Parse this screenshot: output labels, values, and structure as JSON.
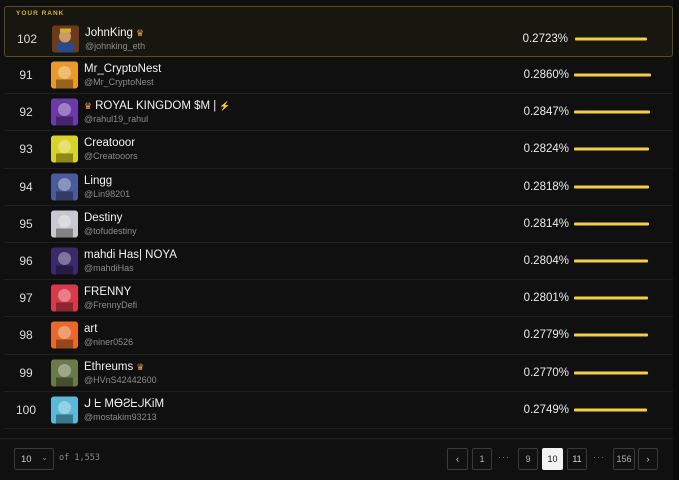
{
  "your_rank_label": "YOUR RANK",
  "my_entry": {
    "rank": "102",
    "name": "JohnKing",
    "handle": "@johnking_eth",
    "pct": "0.2723%",
    "share": 0.9,
    "crown": true
  },
  "entries": [
    {
      "rank": "91",
      "name": "Mr_CryptoNest",
      "handle": "@Mr_CryptoNest",
      "pct": "0.2860%",
      "share": 0.96,
      "crown": false,
      "prefix_crown": false,
      "bolt": false
    },
    {
      "rank": "92",
      "name": "ROYAL KINGDOM $M |",
      "handle": "@rahul19_rahul",
      "pct": "0.2847%",
      "share": 0.95,
      "crown": false,
      "prefix_crown": true,
      "bolt": true
    },
    {
      "rank": "93",
      "name": "Creatooor",
      "handle": "@Creatooors",
      "pct": "0.2824%",
      "share": 0.94,
      "crown": false,
      "prefix_crown": false,
      "bolt": false
    },
    {
      "rank": "94",
      "name": "Lingg",
      "handle": "@Lin98201",
      "pct": "0.2818%",
      "share": 0.94,
      "crown": false,
      "prefix_crown": false,
      "bolt": false
    },
    {
      "rank": "95",
      "name": "Destiny",
      "handle": "@tofudestiny",
      "pct": "0.2814%",
      "share": 0.94,
      "crown": false,
      "prefix_crown": false,
      "bolt": false
    },
    {
      "rank": "96",
      "name": "mahdi Has| NOYA",
      "handle": "@mahdiHas",
      "pct": "0.2804%",
      "share": 0.93,
      "crown": false,
      "prefix_crown": false,
      "bolt": false
    },
    {
      "rank": "97",
      "name": "FRENNY",
      "handle": "@FrennyDefi",
      "pct": "0.2801%",
      "share": 0.93,
      "crown": false,
      "prefix_crown": false,
      "bolt": false
    },
    {
      "rank": "98",
      "name": "art",
      "handle": "@niner0526",
      "pct": "0.2779%",
      "share": 0.92,
      "crown": false,
      "prefix_crown": false,
      "bolt": false
    },
    {
      "rank": "99",
      "name": "Ethreums",
      "handle": "@HVnS42442600",
      "pct": "0.2770%",
      "share": 0.92,
      "crown": true,
      "prefix_crown": false,
      "bolt": false
    },
    {
      "rank": "100",
      "name": "ᒍ ᖶ MӨƧᖶᒍKiM",
      "handle": "@mostakim93213",
      "pct": "0.2749%",
      "share": 0.91,
      "crown": false,
      "prefix_crown": false,
      "bolt": false
    }
  ],
  "avatar_colors": [
    "#8a4a2a",
    "#e89a2a",
    "#6a3aa8",
    "#d9d22a",
    "#4a5a9a",
    "#c8c8d0",
    "#3a2a6a",
    "#d83a4a",
    "#e86a2a",
    "#6a7a4a",
    "#5ab8d8"
  ],
  "footer": {
    "per_page": "10",
    "of_total": "of 1,553",
    "pages": [
      "1",
      "9",
      "10",
      "11",
      "156"
    ],
    "active_page": "10"
  },
  "colors": {
    "accent": "#f5cf43",
    "crown": "#f0a44a"
  }
}
